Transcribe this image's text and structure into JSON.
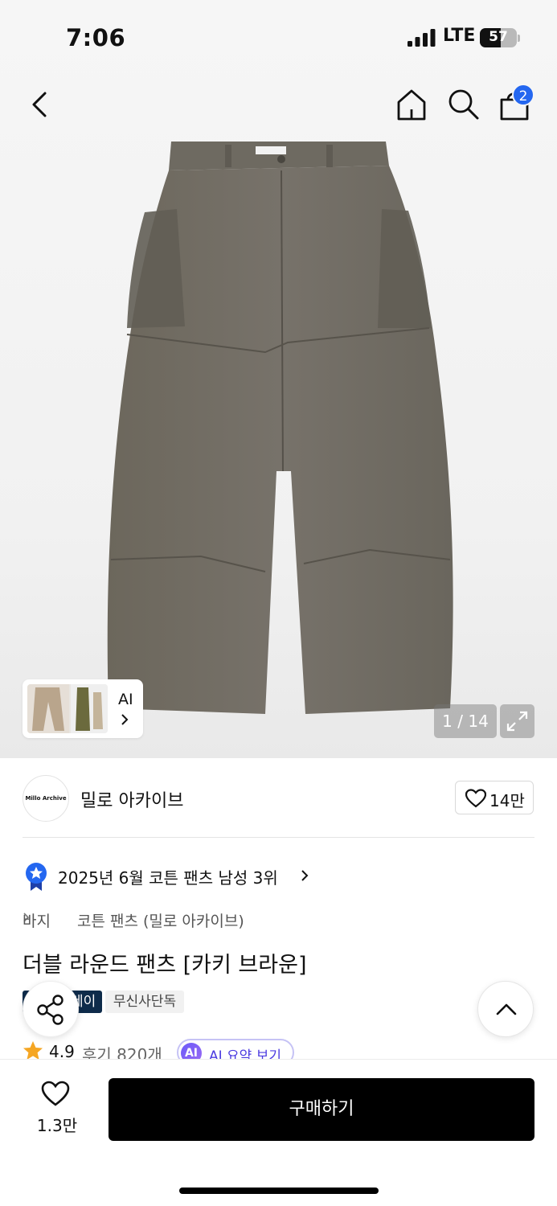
{
  "status_bar": {
    "time": "7:06",
    "network": "LTE",
    "battery": "57",
    "battery_level": 0.57
  },
  "header": {
    "cart_count": "2"
  },
  "gallery": {
    "ai_label": "AI",
    "counter": "1 / 14"
  },
  "brand": {
    "logo_text": "Millo Archive",
    "name": "밀로 아카이브",
    "likes": "14만"
  },
  "ranking": {
    "text": "2025년 6월 코튼 팬츠 남성 3위"
  },
  "breadcrumb": {
    "items": [
      "바지",
      "코튼 팬츠 (밀로 아카이브)"
    ]
  },
  "product": {
    "title": "더블 라운드 팬츠 [카키 브라운]",
    "tags": [
      "플러스페이",
      "무신사단독"
    ],
    "tag_visible_fragment": "레이",
    "rating": "4.9",
    "reviews": "후기 820개",
    "ai_summary": "AI 요약 보기",
    "ai_badge": "AI"
  },
  "bottom": {
    "wish_count": "1.3만",
    "buy_label": "구매하기"
  },
  "colors": {
    "accent": "#2467f0",
    "buy": "#000000",
    "ai": "#6a5af9",
    "star": "#f5a623",
    "tag_dark": "#0e2b4a"
  }
}
